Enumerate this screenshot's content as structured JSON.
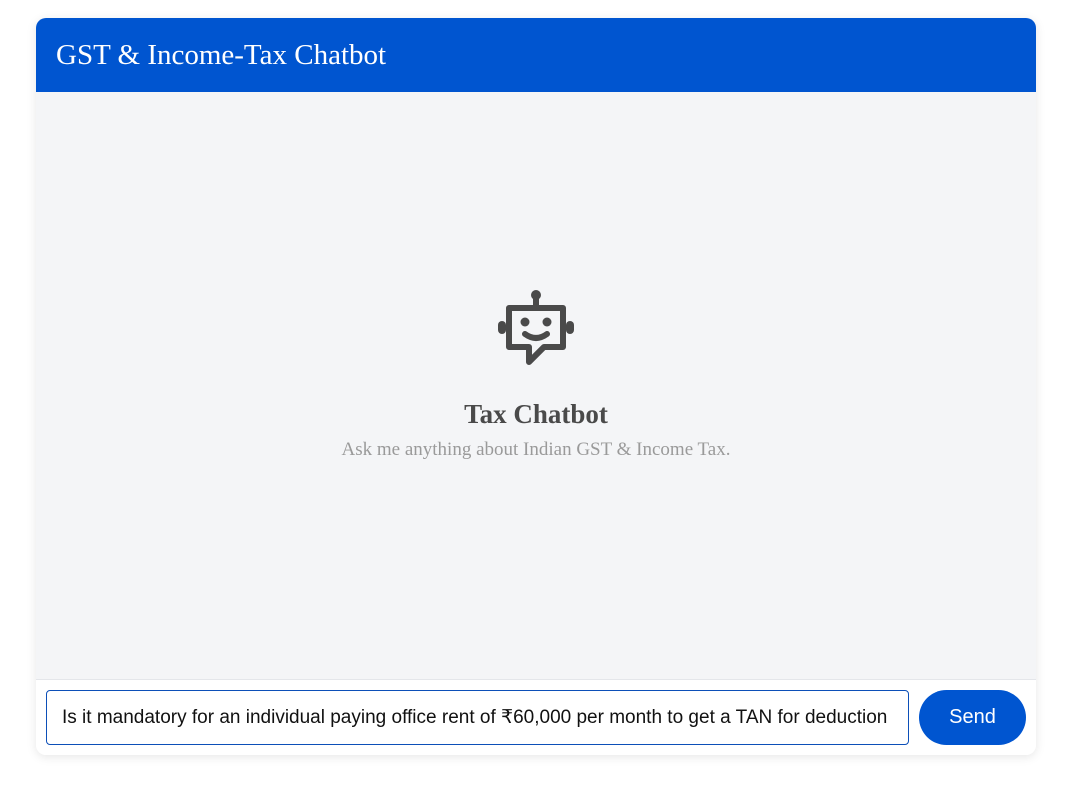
{
  "header": {
    "title": "GST & Income-Tax Chatbot"
  },
  "empty_state": {
    "icon": "robot-chat-icon",
    "title": "Tax Chatbot",
    "subtitle": "Ask me anything about Indian GST & Income Tax."
  },
  "composer": {
    "input_value": "Is it mandatory for an individual paying office rent of ₹60,000 per month to get a TAN for deduction of TDS?",
    "send_label": "Send"
  },
  "colors": {
    "brand": "#0055d0",
    "chat_background": "#f4f5f7",
    "icon": "#4a4a4a"
  }
}
